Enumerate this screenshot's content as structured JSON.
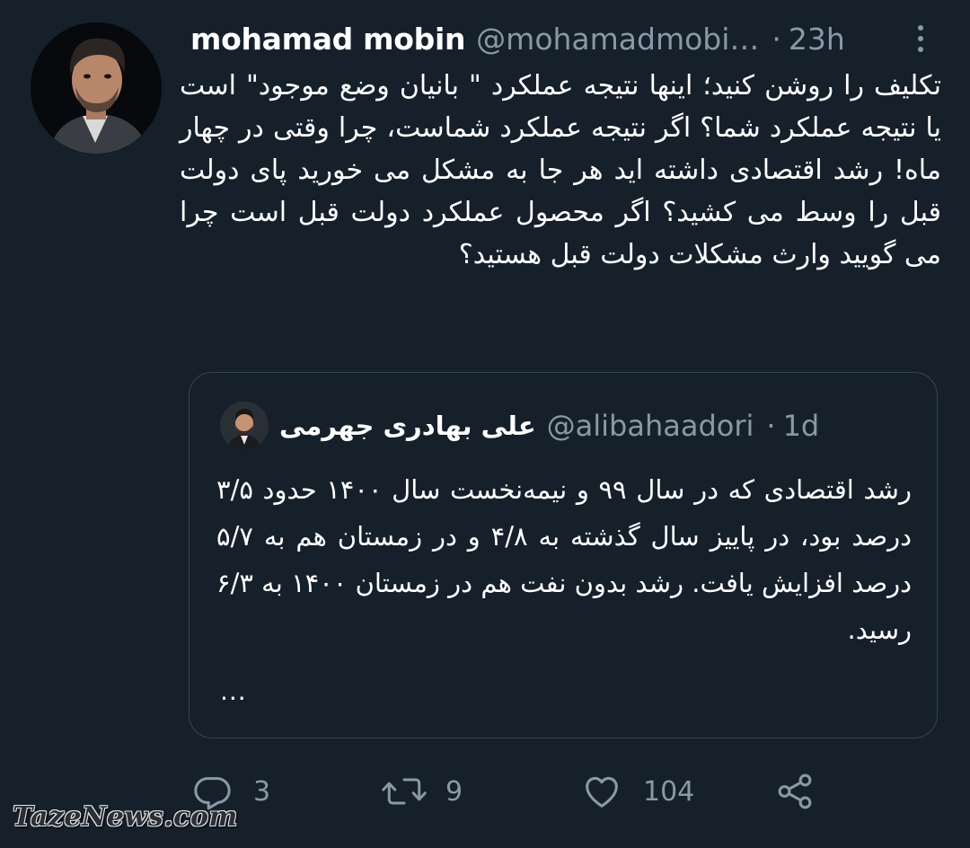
{
  "tweet": {
    "author_name": "mohamad mobin",
    "handle": "@mohamadmobi…",
    "separator": "·",
    "time": "23h",
    "text": "تکلیف را روشن کنید؛ اینها نتیجه عملکرد \" بانیان وضع موجود\" است یا نتیجه عملکرد شما؟ اگر نتیجه عملکرد شماست، چرا وقتی در چهار ماه! رشد اقتصادی داشته اید هر جا به مشکل می خورید پای دولت قبل را وسط می کشید؟ اگر محصول عملکرد دولت قبل است چرا می گویید وارث مشکلات دولت قبل هستید؟",
    "avatar_icon": "profile-photo"
  },
  "quoted_tweet": {
    "author_name": "علی بهادری جهرمی",
    "handle": "@alibahaadori",
    "separator": "·",
    "time": "1d",
    "text": "رشد اقتصادی که در سال ۹۹ و نیمه‌نخست سال ۱۴۰۰ حدود ۳/۵ درصد بود، در پاییز سال گذشته به ۴/۸ و در زمستان هم به ۵/۷ درصد افزایش یافت. رشد بدون نفت هم در زمستان ۱۴۰۰ به ۶/۳ رسید.",
    "ellipsis": "...",
    "avatar_icon": "profile-photo"
  },
  "actions": {
    "reply_count": "3",
    "retweet_count": "9",
    "like_count": "104",
    "icons": [
      "reply-icon",
      "retweet-icon",
      "like-icon",
      "share-icon"
    ]
  },
  "watermark": "TazeNews.com",
  "colors": {
    "background": "#15202b",
    "text": "#ffffff",
    "secondary": "#8b98a5",
    "border": "#38444d"
  }
}
